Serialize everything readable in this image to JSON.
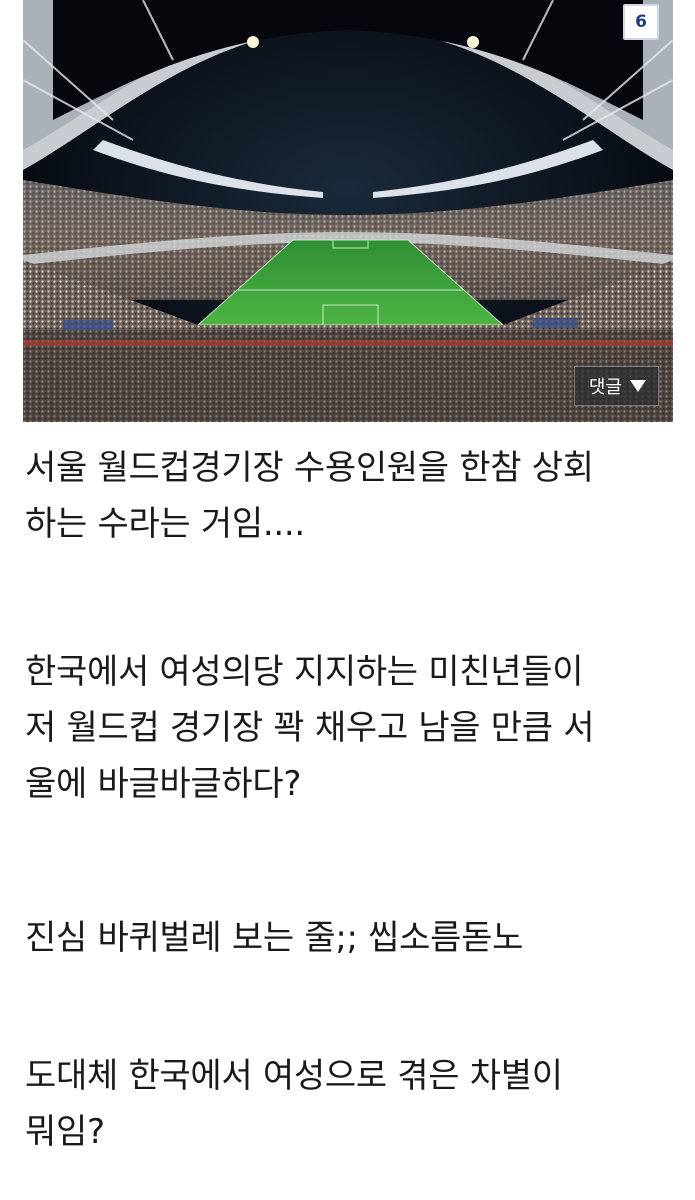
{
  "image": {
    "page_number": "6",
    "comment_button_label": "댓글",
    "colors": {
      "sky": "#05070d",
      "pitch": "#3fa33a",
      "badge_text": "#1d3d78"
    }
  },
  "post": {
    "paragraphs": [
      "서울 월드컵경기장 수용인원을 한참 상회\n하는 수라는 거임....",
      "한국에서 여성의당 지지하는 미친년들이\n저 월드컵 경기장 꽉 채우고 남을 만큼 서\n울에 바글바글하다?",
      "진심 바퀴벌레 보는 줄;; 씹소름돋노",
      "도대체 한국에서 여성으로 겪은 차별이\n뭐임?"
    ]
  }
}
